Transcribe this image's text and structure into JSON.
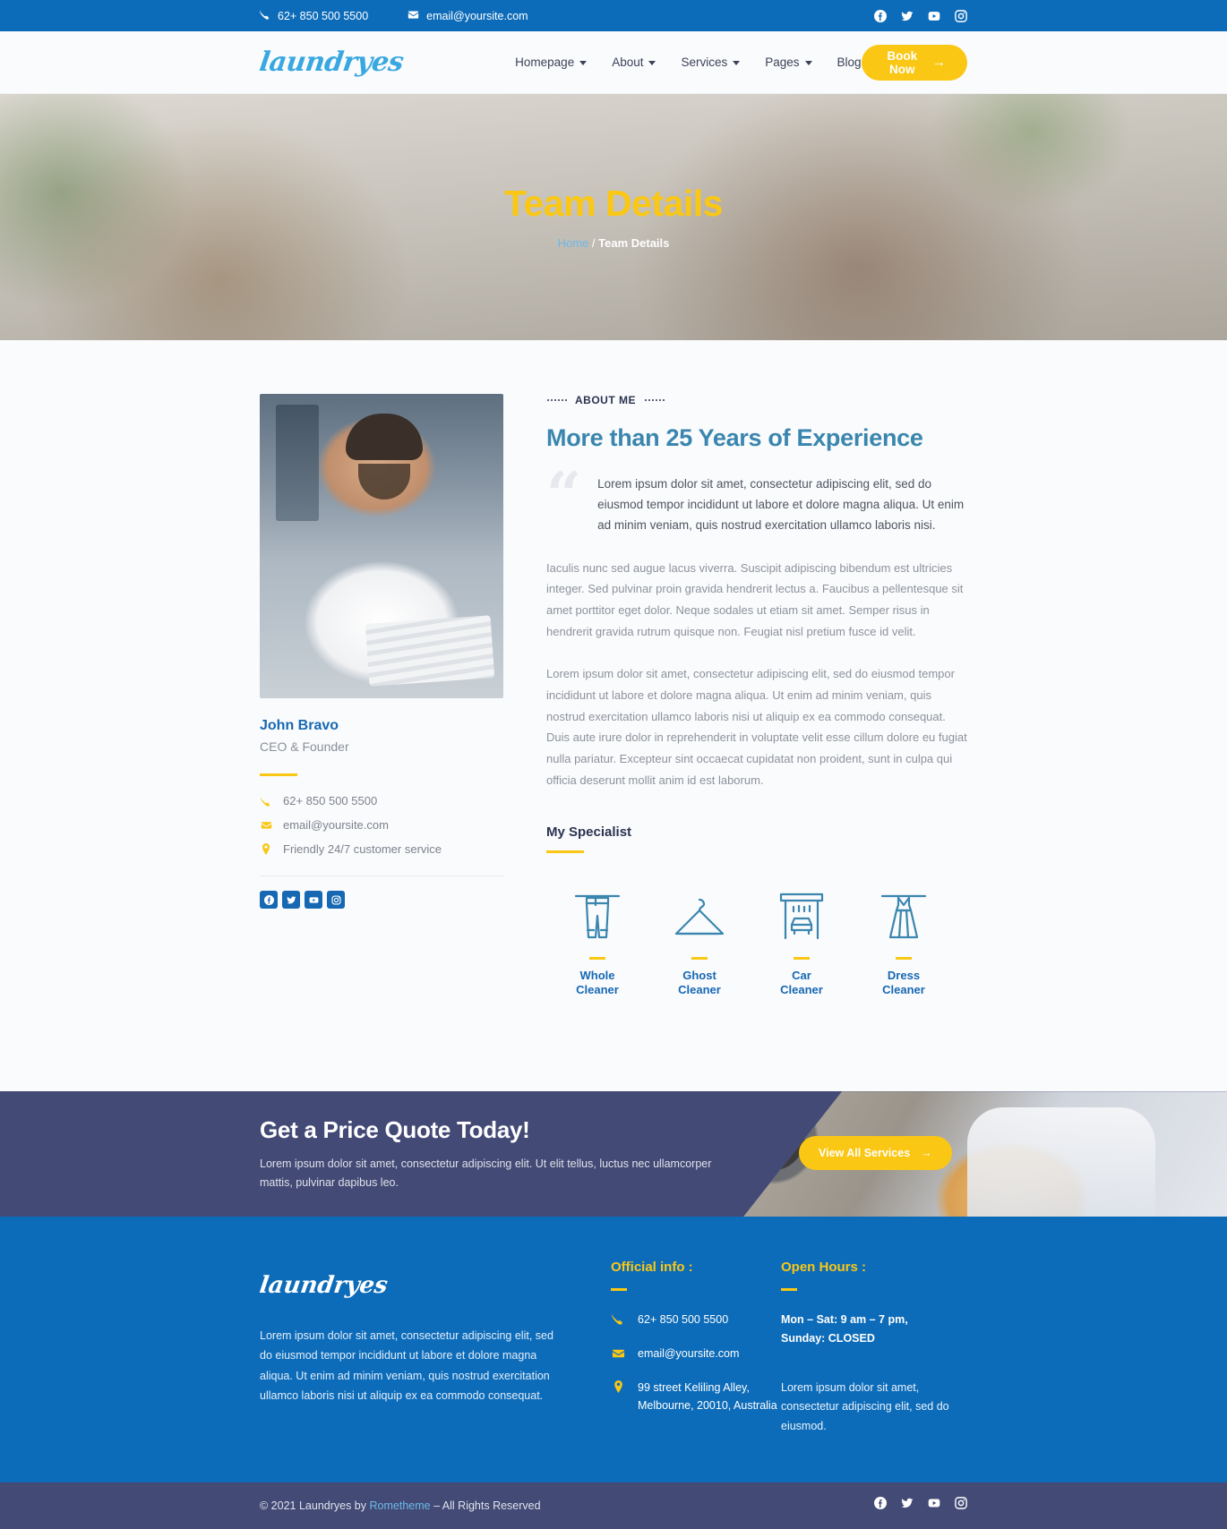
{
  "topbar": {
    "phone": "62+ 850 500 5500",
    "email": "email@yoursite.com",
    "socials": [
      "facebook-icon",
      "twitter-icon",
      "youtube-icon",
      "instagram-icon"
    ]
  },
  "header": {
    "logo": "laundryes",
    "nav": [
      {
        "label": "Homepage",
        "has_caret": true
      },
      {
        "label": "About",
        "has_caret": true
      },
      {
        "label": "Services",
        "has_caret": true
      },
      {
        "label": "Pages",
        "has_caret": true
      },
      {
        "label": "Blog",
        "has_caret": false
      }
    ],
    "cta_label": "Book Now",
    "cta_arrow": "→"
  },
  "hero": {
    "title": "Team Details",
    "breadcrumb_home": "Home",
    "breadcrumb_sep": " / ",
    "breadcrumb_current": "Team Details"
  },
  "profile": {
    "name": "John Bravo",
    "role": "CEO & Founder",
    "contacts": [
      {
        "icon": "phone-icon",
        "text": "62+ 850 500 5500"
      },
      {
        "icon": "envelope-icon",
        "text": "email@yoursite.com"
      },
      {
        "icon": "map-pin-icon",
        "text": "Friendly 24/7 customer service"
      }
    ],
    "socials": [
      "facebook-icon",
      "twitter-icon",
      "youtube-icon",
      "instagram-icon"
    ]
  },
  "about": {
    "eyebrow": "ABOUT ME",
    "heading": "More than 25 Years of Experience",
    "quote": "Lorem ipsum dolor sit amet, consectetur adipiscing elit, sed do eiusmod tempor incididunt ut labore et dolore magna aliqua. Ut enim ad minim veniam, quis nostrud exercitation ullamco laboris nisi.",
    "paragraph1": "Iaculis nunc sed augue lacus viverra. Suscipit adipiscing bibendum est ultricies integer. Sed pulvinar proin gravida hendrerit lectus a. Faucibus a pellentesque sit amet porttitor eget dolor. Neque sodales ut etiam sit amet. Semper risus in hendrerit gravida rutrum quisque non. Feugiat nisl pretium fusce id velit.",
    "paragraph2": "Lorem ipsum dolor sit amet, consectetur adipiscing elit, sed do eiusmod tempor incididunt ut labore et dolore magna aliqua. Ut enim ad minim veniam, quis nostrud exercitation ullamco laboris nisi ut aliquip ex ea commodo consequat. Duis aute irure dolor in reprehenderit in voluptate velit esse cillum dolore eu fugiat nulla pariatur. Excepteur sint occaecat cupidatat non proident, sunt in culpa qui officia deserunt mollit anim id est laborum."
  },
  "specialist": {
    "heading": "My Specialist",
    "items": [
      {
        "icon": "hanging-pants-icon",
        "line1": "Whole",
        "line2": "Cleaner"
      },
      {
        "icon": "clothes-hanger-icon",
        "line1": "Ghost",
        "line2": "Cleaner"
      },
      {
        "icon": "car-wash-icon",
        "line1": "Car",
        "line2": "Cleaner"
      },
      {
        "icon": "hanging-dress-icon",
        "line1": "Dress",
        "line2": "Cleaner"
      }
    ]
  },
  "cta": {
    "title": "Get a Price Quote Today!",
    "subtitle": "Lorem ipsum dolor sit amet, consectetur adipiscing elit. Ut elit tellus, luctus nec ullamcorper mattis, pulvinar dapibus leo.",
    "button_label": "View All Services",
    "button_arrow": "→"
  },
  "footer": {
    "logo": "laundryes",
    "description": "Lorem ipsum dolor sit amet, consectetur adipiscing elit, sed do eiusmod tempor incididunt ut labore et dolore magna aliqua. Ut enim ad minim veniam, quis nostrud exercitation ullamco laboris nisi ut aliquip ex ea commodo consequat.",
    "official_heading": "Official info :",
    "official_items": [
      {
        "icon": "phone-icon",
        "text": "62+ 850 500 5500"
      },
      {
        "icon": "envelope-icon",
        "text": "email@yoursite.com"
      },
      {
        "icon": "map-pin-icon",
        "text": "99 street Keliling Alley, Melbourne, 20010, Australia"
      }
    ],
    "hours_heading": "Open Hours :",
    "hours_text": "Mon – Sat: 9 am – 7 pm, Sunday: CLOSED",
    "hours_note": "Lorem ipsum dolor sit amet, consectetur adipiscing elit, sed do eiusmod."
  },
  "bottombar": {
    "copyright_prefix": "© 2021 Laundryes by ",
    "brand_link": "Rometheme",
    "copyright_suffix": " – All Rights Reserved",
    "socials": [
      "facebook-icon",
      "twitter-icon",
      "youtube-icon",
      "instagram-icon"
    ]
  },
  "colors": {
    "primary_blue": "#0d6cb9",
    "accent_yellow": "#fac714",
    "navy": "#434a75",
    "steel_blue": "#3a86ae",
    "page_bg": "#fafbfd"
  }
}
